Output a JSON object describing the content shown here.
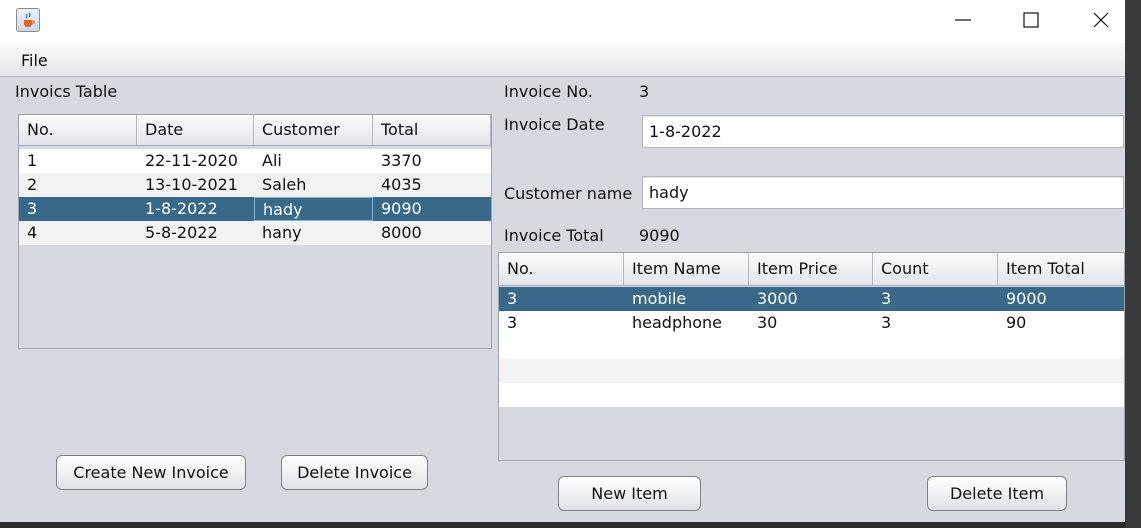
{
  "window": {
    "title": ""
  },
  "menu": {
    "file": "File"
  },
  "invoices": {
    "title": "Invoics Table",
    "columns": [
      "No.",
      "Date",
      "Customer",
      "Total"
    ],
    "rows": [
      [
        "1",
        "22-11-2020",
        "Ali",
        "3370"
      ],
      [
        "2",
        "13-10-2021",
        "Saleh",
        "4035"
      ],
      [
        "3",
        "1-8-2022",
        "hady",
        "9090"
      ],
      [
        "4",
        "5-8-2022",
        "hany",
        "8000"
      ]
    ],
    "selected_row": 2
  },
  "details": {
    "invoice_no_label": "Invoice No.",
    "invoice_no_value": "3",
    "invoice_date_label": "Invoice Date",
    "invoice_date_value": "1-8-2022",
    "customer_label": "Customer name",
    "customer_value": "hady",
    "total_label": "Invoice Total",
    "total_value": "9090"
  },
  "items": {
    "columns": [
      "No.",
      "Item Name",
      "Item Price",
      "Count",
      "Item Total"
    ],
    "rows": [
      [
        "3",
        "mobile",
        "3000",
        "3",
        "9000"
      ],
      [
        "3",
        "headphone",
        "30",
        "3",
        "90"
      ]
    ],
    "selected_row": 0
  },
  "buttons": {
    "create_invoice": "Create New Invoice",
    "delete_invoice": "Delete Invoice",
    "new_item": "New Item",
    "delete_item": "Delete Item"
  },
  "colors": {
    "selection": "#39698a",
    "panel": "#d6d9df"
  },
  "icons": {
    "app": "java-cup-icon",
    "minimize": "minimize-icon",
    "maximize": "maximize-icon",
    "close": "close-icon"
  }
}
